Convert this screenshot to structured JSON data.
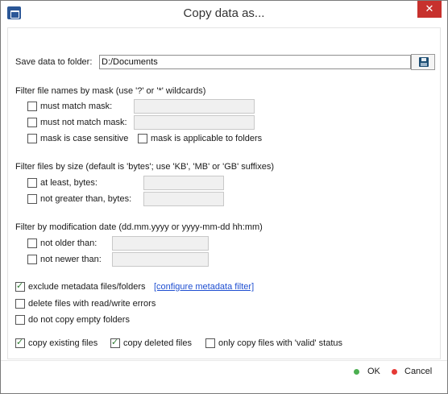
{
  "window": {
    "title": "Copy data as...",
    "close_glyph": "✕"
  },
  "save": {
    "label": "Save data to folder:",
    "path": "D:/Documents",
    "button_icon": "floppy-disk-icon"
  },
  "mask": {
    "header": "Filter file names by mask (use '?' or '*' wildcards)",
    "must_match": {
      "label": "must match mask:",
      "checked": false,
      "value": ""
    },
    "must_not_match": {
      "label": "must not match mask:",
      "checked": false,
      "value": ""
    },
    "case_sensitive": {
      "label": "mask is case sensitive",
      "checked": false
    },
    "applicable_folders": {
      "label": "mask is applicable to folders",
      "checked": false
    }
  },
  "size": {
    "header": "Filter files by size (default is 'bytes'; use 'KB', 'MB' or 'GB' suffixes)",
    "at_least": {
      "label": "at least, bytes:",
      "checked": false,
      "value": ""
    },
    "not_greater": {
      "label": "not greater than, bytes:",
      "checked": false,
      "value": ""
    }
  },
  "date": {
    "header": "Filter by modification date (dd.mm.yyyy or yyyy-mm-dd hh:mm)",
    "not_older": {
      "label": "not older than:",
      "checked": false,
      "value": ""
    },
    "not_newer": {
      "label": "not newer than:",
      "checked": false,
      "value": ""
    }
  },
  "options": {
    "exclude_metadata": {
      "label": "exclude metadata files/folders",
      "checked": true
    },
    "configure_link": "[configure metadata filter]",
    "delete_errors": {
      "label": "delete files with read/write errors",
      "checked": false
    },
    "no_empty_folders": {
      "label": "do not copy empty folders",
      "checked": false
    },
    "copy_existing": {
      "label": "copy existing files",
      "checked": true
    },
    "copy_deleted": {
      "label": "copy deleted files",
      "checked": true
    },
    "only_valid": {
      "label": "only copy files with 'valid' status",
      "checked": false
    }
  },
  "footer": {
    "ok_label": "OK",
    "cancel_label": "Cancel",
    "ok_color": "#4caf50",
    "cancel_color": "#e53935"
  },
  "colors": {
    "close_button": "#c7312d",
    "link": "#1f4fd1",
    "check": "#2e7d32"
  }
}
